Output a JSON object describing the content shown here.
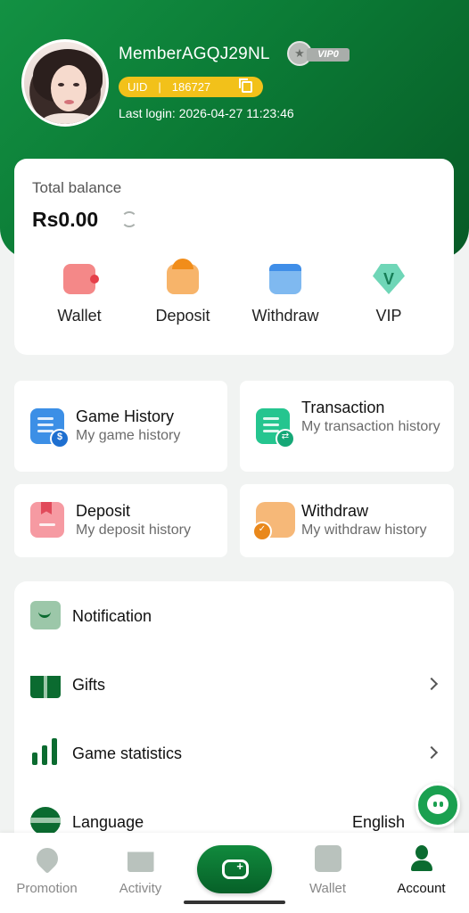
{
  "profile": {
    "username": "MemberAGQJ29NL",
    "vip_level": "VIP0",
    "uid_label": "UID",
    "uid_separator": "|",
    "uid_value": "186727",
    "last_login": "Last login: 2026-04-27 11:23:46"
  },
  "balance": {
    "label": "Total balance",
    "amount": "Rs0.00"
  },
  "quick_actions": [
    {
      "label": "Wallet",
      "icon": "wallet-icon"
    },
    {
      "label": "Deposit",
      "icon": "deposit-icon"
    },
    {
      "label": "Withdraw",
      "icon": "withdraw-icon"
    },
    {
      "label": "VIP",
      "icon": "vip-icon"
    }
  ],
  "vip_icon_letter": "V",
  "history_cards": [
    {
      "title": "Game History",
      "subtitle": "My game history",
      "icon": "game-history-icon"
    },
    {
      "title": "Transaction",
      "subtitle": "My transaction history",
      "icon": "transaction-icon"
    },
    {
      "title": "Deposit",
      "subtitle": "My deposit history",
      "icon": "deposit-history-icon"
    },
    {
      "title": "Withdraw",
      "subtitle": "My withdraw history",
      "icon": "withdraw-history-icon"
    }
  ],
  "settings": [
    {
      "label": "Notification",
      "icon": "notification-icon"
    },
    {
      "label": "Gifts",
      "icon": "gift-icon"
    },
    {
      "label": "Game statistics",
      "icon": "statistics-icon"
    },
    {
      "label": "Language",
      "icon": "language-icon",
      "value": "English"
    }
  ],
  "tabbar": [
    {
      "label": "Promotion",
      "icon": "promotion-icon",
      "active": false
    },
    {
      "label": "Activity",
      "icon": "activity-icon",
      "active": false
    },
    {
      "label": "",
      "icon": "game-controller-icon",
      "active": false
    },
    {
      "label": "Wallet",
      "icon": "wallet-tab-icon",
      "active": false
    },
    {
      "label": "Account",
      "icon": "account-icon",
      "active": true
    }
  ],
  "colors": {
    "brand_green": "#0b7a35",
    "uid_pill": "#f2c11a",
    "page_bg": "#f1f3f2"
  }
}
